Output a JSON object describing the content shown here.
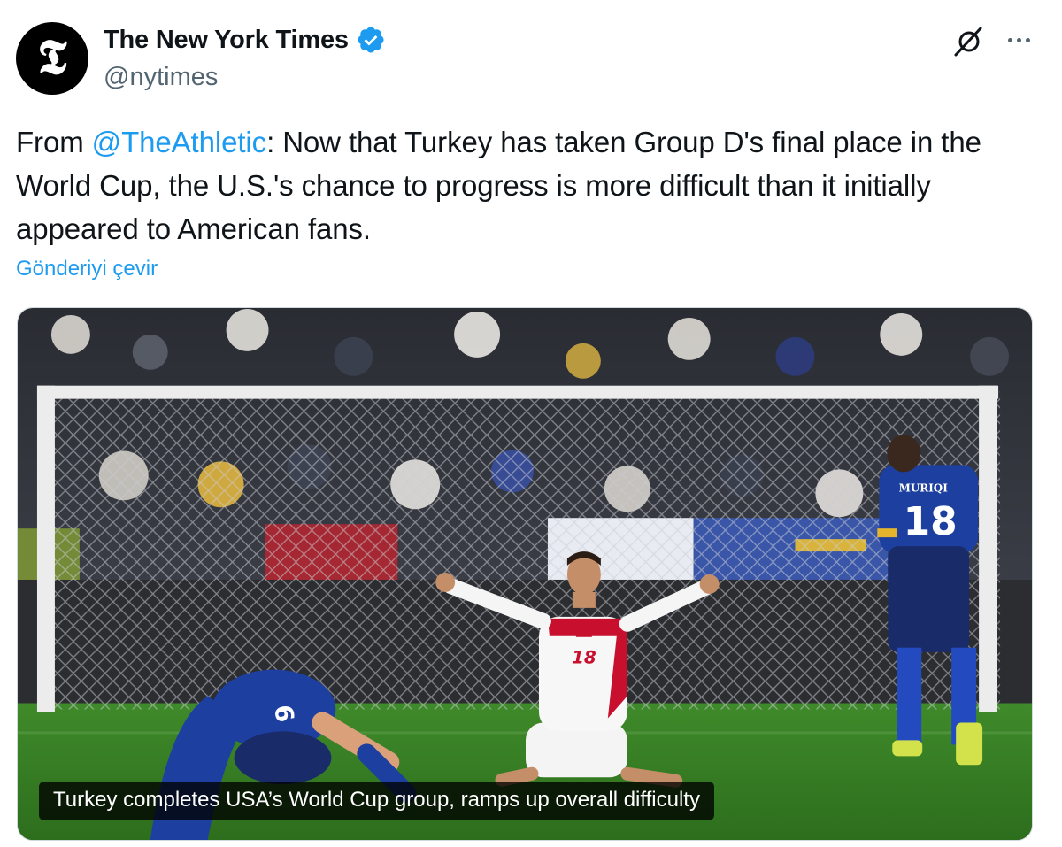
{
  "author": {
    "display_name": "The New York Times",
    "handle": "@nytimes",
    "avatar_glyph": "𝕿",
    "verified_icon": "verified-badge-icon",
    "verified_color": "#1d9bf0"
  },
  "actions": {
    "grok_icon": "grok-icon",
    "more_icon": "more-options-icon"
  },
  "tweet": {
    "prefix": "From ",
    "mention": "@TheAthletic",
    "body": ": Now that Turkey has taken Group D's final place in the World Cup, the U.S.'s chance to progress is more difficult than it initially appeared to American fans."
  },
  "translate_label": "Gönderiyi çevir",
  "media": {
    "caption": "Turkey completes USA’s World Cup group, ramps up overall difficulty",
    "jersey_right_name": "MURIQI",
    "jersey_right_number": "18",
    "jersey_center_number": "18",
    "jersey_left_number": "6"
  },
  "colors": {
    "text": "#0f1419",
    "secondary": "#536471",
    "link": "#1d9bf0",
    "turkey_red": "#c8102e",
    "kosovo_blue": "#1d3fa0"
  }
}
